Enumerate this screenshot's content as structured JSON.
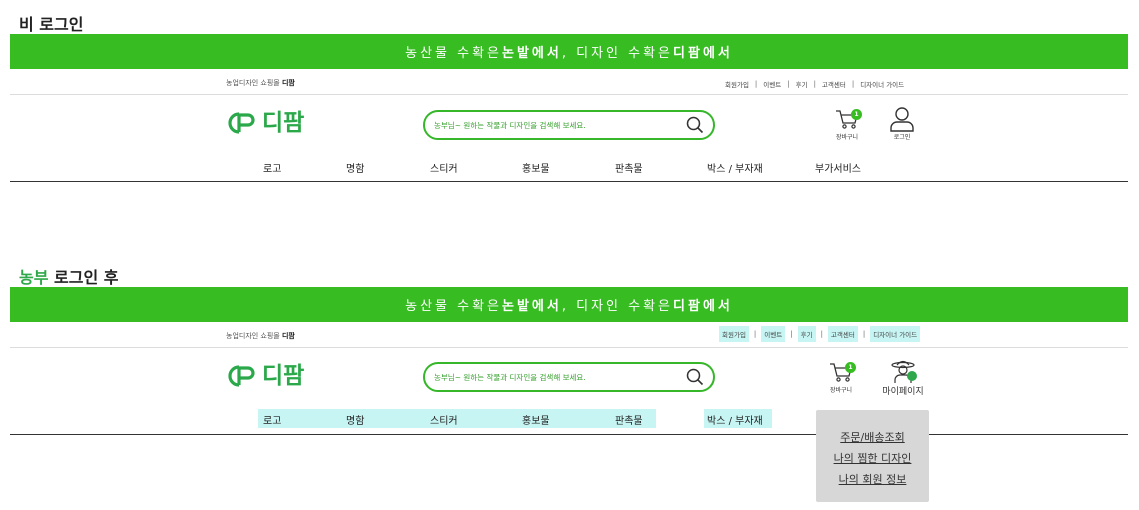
{
  "section1": {
    "title": "비 로그인"
  },
  "section2": {
    "title_accent": "농부",
    "title_rest": " 로그인 후"
  },
  "banner": {
    "part1": "농산물 수확은 ",
    "bold1": "논밭에서",
    "part2": ", 디자인 수확은 ",
    "bold2": "디팜에서"
  },
  "mall": {
    "text": "농업디자인 쇼핑몰 ",
    "brand": "디팜"
  },
  "util_links": [
    "회원가입",
    "이벤트",
    "후기",
    "고객센터",
    "디자이너 가이드"
  ],
  "util_separator": "|",
  "logo": {
    "text": "디팜"
  },
  "search": {
    "placeholder": "농부님~ 원하는 작물과 디자인을 검색해 보세요."
  },
  "cart": {
    "label": "장바구니",
    "count": "1"
  },
  "login": {
    "label": "로그인"
  },
  "mypage": {
    "label": "마이페이지"
  },
  "nav": [
    "로고",
    "명함",
    "스티커",
    "홍보물",
    "판촉물",
    "박스 / 부자재",
    "부가서비스"
  ],
  "dropdown": [
    "주문/배송조회",
    "나의 찜한 디자인",
    "나의 회원 정보"
  ],
  "colors": {
    "banner": "#37bd22",
    "logo": "#2ba84a",
    "highlight": "#c6f5f3",
    "dropdown": "#d7d7d7"
  }
}
